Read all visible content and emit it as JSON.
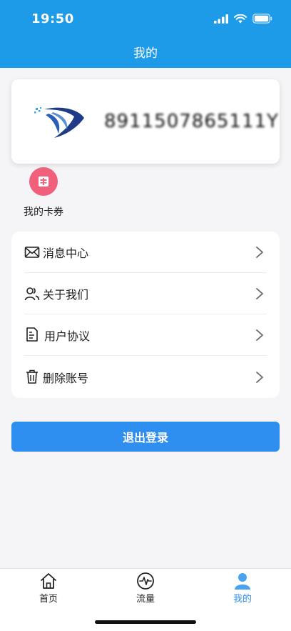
{
  "status_bar": {
    "time": "19:50"
  },
  "header": {
    "title": "我的"
  },
  "card": {
    "number": "8911507865111Y"
  },
  "coupons": {
    "label": "我的卡券"
  },
  "menu": {
    "items": [
      {
        "icon": "mail-icon",
        "label": "消息中心"
      },
      {
        "icon": "users-icon",
        "label": "关于我们"
      },
      {
        "icon": "document-icon",
        "label": "用户协议"
      },
      {
        "icon": "trash-icon",
        "label": "删除账号"
      }
    ]
  },
  "logout": {
    "label": "退出登录"
  },
  "tabbar": {
    "tabs": [
      {
        "label": "首页",
        "icon": "home-icon"
      },
      {
        "label": "流量",
        "icon": "traffic-icon"
      },
      {
        "label": "我的",
        "icon": "profile-icon"
      }
    ],
    "active": 2
  },
  "colors": {
    "primary": "#1e9be8",
    "button": "#2f8ff0",
    "coupon": "#f0607a"
  }
}
